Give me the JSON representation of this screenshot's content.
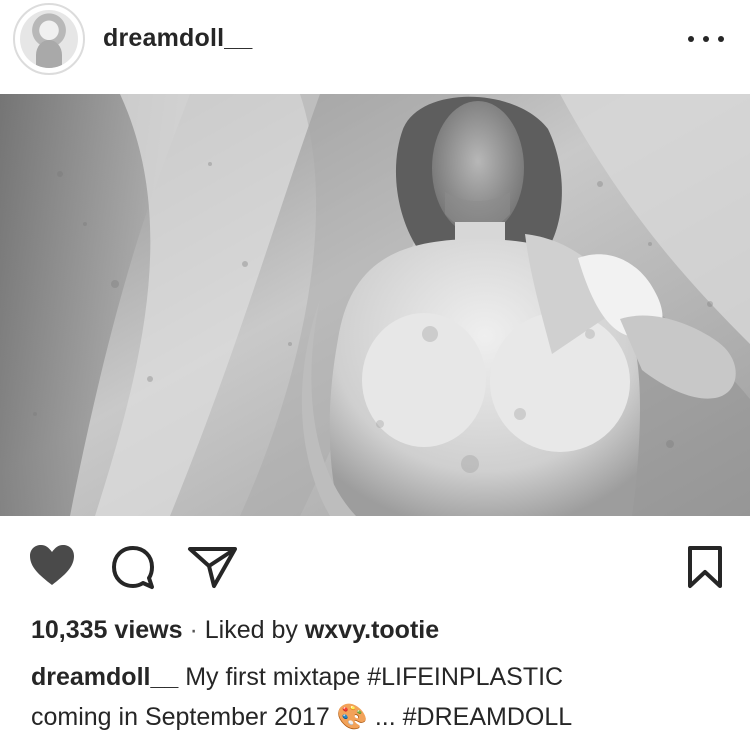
{
  "post": {
    "username": "dreamdoll__",
    "views": "10,335 views",
    "separator": "·",
    "liked_by_prefix": "Liked by",
    "liked_by_user": "wxvy.tootie",
    "caption_user": "dreamdoll__",
    "caption_line1": "My first mixtape #LIFEINPLASTIC",
    "caption_line2_start": "coming in September 2017",
    "caption_emoji": "🎨",
    "caption_line2_end": "... #DREAMDOLL"
  },
  "icons": {
    "more": "more-options-icon",
    "like": "heart-icon",
    "comment": "comment-icon",
    "share": "send-icon",
    "save": "bookmark-icon"
  },
  "colors": {
    "text": "#262626",
    "icon": "#262626",
    "heart_fill": "#4a4a4a",
    "photo_tone": "#9a9a9a"
  }
}
